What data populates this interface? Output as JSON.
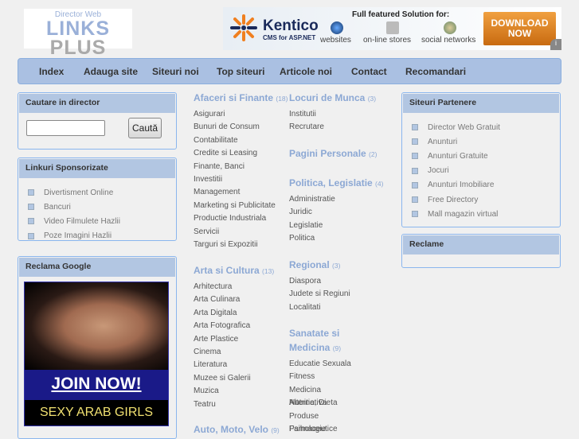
{
  "logo": {
    "subtitle": "Director Web",
    "word1": "LINKS",
    "word2": "PLUS"
  },
  "banner": {
    "brand": "Kentico",
    "brand_sub": "CMS for ASP.NET",
    "headline": "Full featured Solution for:",
    "features": [
      "websites",
      "on-line stores",
      "social networks"
    ],
    "cta": "DOWNLOAD NOW",
    "info": "i"
  },
  "nav": [
    "Index",
    "Adauga site",
    "Siteuri noi",
    "Top siteuri",
    "Articole noi",
    "Contact",
    "Recomandari"
  ],
  "search": {
    "title": "Cautare in director",
    "value": "",
    "button": "Caută"
  },
  "sponsored": {
    "title": "Linkuri Sponsorizate",
    "items": [
      "Divertisment Online",
      "Bancuri",
      "Video Filmulete Hazlii",
      "Poze Imagini Hazlii"
    ]
  },
  "google": {
    "title": "Reclama Google",
    "ad_join": "JOIN NOW!",
    "ad_text": "SEXY ARAB GIRLS",
    "info": "i"
  },
  "partners": {
    "title": "Siteuri Partenere",
    "items": [
      "Director Web Gratuit",
      "Anunturi",
      "Anunturi Gratuite",
      "Jocuri",
      "Anunturi Imobiliare",
      "Free Directory",
      "Mall magazin virtual"
    ]
  },
  "reclame": {
    "title": "Reclame"
  },
  "categories": [
    {
      "name": "Afaceri si Finante",
      "count": "(18)",
      "items": [
        "Asigurari",
        "Bunuri de Consum",
        "Contabilitate",
        "Credite si Leasing",
        "Finante, Banci",
        "Investitii",
        "Management",
        "Marketing si Publicitate",
        "Productie Industriala",
        "Servicii",
        "Targuri si Expozitii"
      ]
    },
    {
      "name": "Arta si Cultura",
      "count": "(13)",
      "items": [
        "Arhitectura",
        "Arta Culinara",
        "Arta Digitala",
        "Arta Fotografica",
        "Arte Plastice",
        "Cinema",
        "Literatura",
        "Muzee si Galerii",
        "Muzica",
        "Teatru"
      ]
    },
    {
      "name": "Auto, Moto, Velo",
      "count": "(9)",
      "items": []
    },
    {
      "name": "Locuri de Munca",
      "count": "(3)",
      "items": [
        "Institutii",
        "Recrutare"
      ]
    },
    {
      "name": "Pagini Personale",
      "count": "(2)",
      "items": []
    },
    {
      "name": "Politica, Legislatie",
      "count": "(4)",
      "items": [
        "Administratie",
        "Juridic",
        "Legislatie",
        "Politica"
      ]
    },
    {
      "name": "Regional",
      "count": "(3)",
      "items": [
        "Diaspora",
        "Judete si Regiuni",
        "Localitati"
      ]
    },
    {
      "name": "Sanatate si Medicina",
      "count": "(9)",
      "items": [
        "Educatie Sexuala",
        "Fitness",
        "Medicina Alternativa",
        "Nutritie, Dieta",
        "Produse Farmaceutice",
        "Psihologie"
      ]
    }
  ],
  "colors": {
    "panel_header": "#b2c6e2",
    "panel_border": "#8ab6ee",
    "category_heading": "#8ca8d4",
    "background": "#f0f0f0"
  }
}
